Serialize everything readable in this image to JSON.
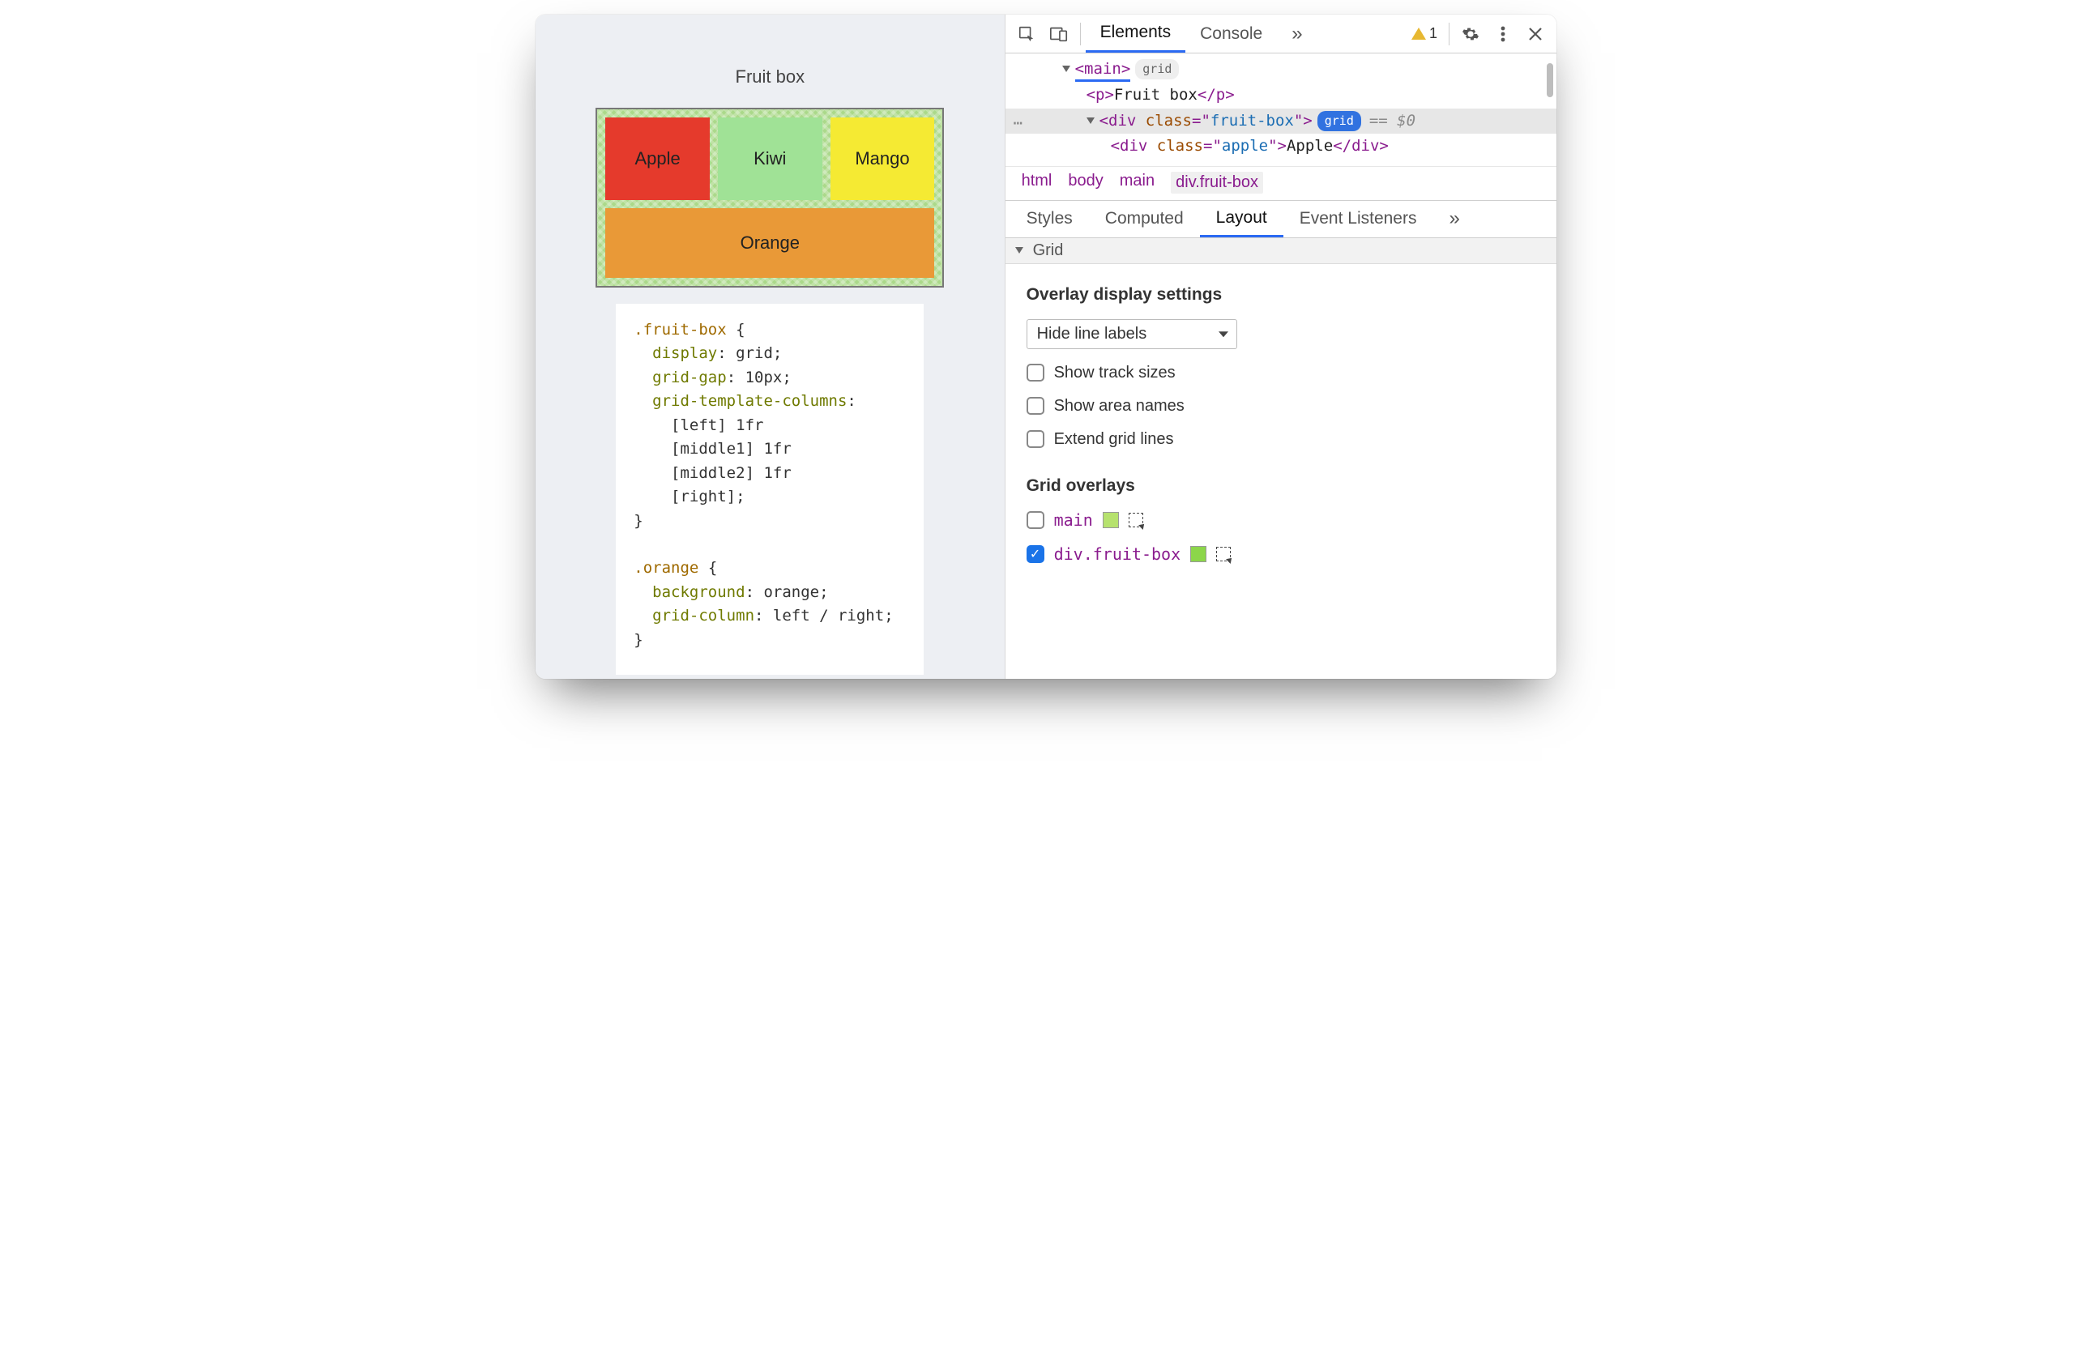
{
  "demo": {
    "title": "Fruit box",
    "cells": {
      "apple": "Apple",
      "kiwi": "Kiwi",
      "mango": "Mango",
      "orange": "Orange"
    },
    "css_lines": [
      [
        [
          "sel",
          ".fruit-box"
        ],
        [
          "punct",
          " {"
        ]
      ],
      [
        [
          "prop",
          "  display"
        ],
        [
          "punct",
          ": "
        ],
        [
          "val",
          "grid"
        ],
        [
          "punct",
          ";"
        ]
      ],
      [
        [
          "prop",
          "  grid-gap"
        ],
        [
          "punct",
          ": "
        ],
        [
          "val",
          "10px"
        ],
        [
          "punct",
          ";"
        ]
      ],
      [
        [
          "prop",
          "  grid-template-columns"
        ],
        [
          "punct",
          ":"
        ]
      ],
      [
        [
          "val",
          "    [left] 1fr"
        ]
      ],
      [
        [
          "val",
          "    [middle1] 1fr"
        ]
      ],
      [
        [
          "val",
          "    [middle2] 1fr"
        ]
      ],
      [
        [
          "val",
          "    [right]"
        ],
        [
          "punct",
          ";"
        ]
      ],
      [
        [
          "punct",
          "}"
        ]
      ],
      [
        [
          "",
          ""
        ]
      ],
      [
        [
          "sel",
          ".orange"
        ],
        [
          "punct",
          " {"
        ]
      ],
      [
        [
          "prop",
          "  background"
        ],
        [
          "punct",
          ": "
        ],
        [
          "val",
          "orange"
        ],
        [
          "punct",
          ";"
        ]
      ],
      [
        [
          "prop",
          "  grid-column"
        ],
        [
          "punct",
          ": "
        ],
        [
          "val",
          "left / right"
        ],
        [
          "punct",
          ";"
        ]
      ],
      [
        [
          "punct",
          "}"
        ]
      ]
    ]
  },
  "devtools": {
    "top_tabs": {
      "elements": "Elements",
      "console": "Console"
    },
    "more_glyph": "»",
    "warn_count": "1",
    "dom": {
      "main_open": "main",
      "grid_pill": "grid",
      "p_text": "Fruit box",
      "div_open_attr_name": "class",
      "div_open_attr_val": "fruit-box",
      "selected_badge": "grid",
      "eq_dollar": "== $0",
      "apple_attr_val": "apple",
      "apple_text": "Apple"
    },
    "breadcrumb": [
      "html",
      "body",
      "main",
      "div.fruit-box"
    ],
    "sub_tabs": [
      "Styles",
      "Computed",
      "Layout",
      "Event Listeners"
    ],
    "grid_section": "Grid",
    "overlay_h": "Overlay display settings",
    "line_labels_select": "Hide line labels",
    "cb_tracks": "Show track sizes",
    "cb_areas": "Show area names",
    "cb_extend": "Extend grid lines",
    "overlays_h": "Grid overlays",
    "overlay_main": "main",
    "overlay_fruit": "div.fruit-box"
  }
}
